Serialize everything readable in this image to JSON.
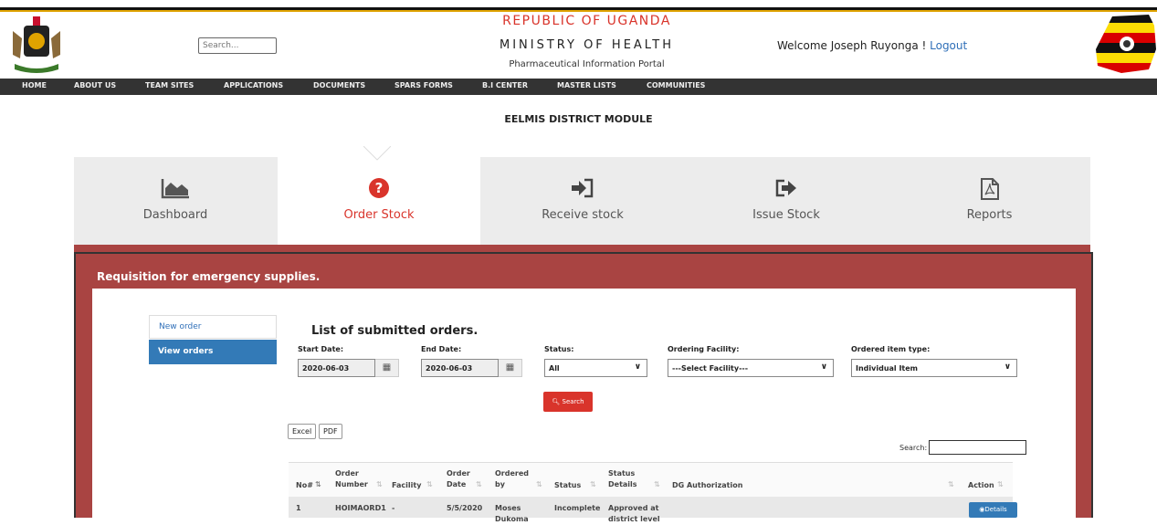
{
  "header": {
    "search_placeholder": "Search...",
    "republic": "REPUBLIC OF UGANDA",
    "ministry": "MINISTRY OF HEALTH",
    "portal": "Pharmaceutical Information Portal",
    "welcome": "Welcome Joseph Ruyonga ! ",
    "logout": "Logout"
  },
  "nav": [
    "HOME",
    "ABOUT US",
    "TEAM SITES",
    "APPLICATIONS",
    "DOCUMENTS",
    "SPARS FORMS",
    "B.I CENTER",
    "MASTER LISTS",
    "COMMUNITIES"
  ],
  "module_title": "EELMIS DISTRICT MODULE",
  "tabs": [
    {
      "label": "Dashboard",
      "icon": "area-chart-icon"
    },
    {
      "label": "Order Stock",
      "icon": "question-circle-icon"
    },
    {
      "label": "Receive stock",
      "icon": "sign-in-icon"
    },
    {
      "label": "Issue Stock",
      "icon": "share-icon"
    },
    {
      "label": "Reports",
      "icon": "pdf-file-icon"
    }
  ],
  "panel_title": "Requisition for emergency supplies.",
  "side_menu": {
    "new_order": "New order",
    "view_orders": "View orders"
  },
  "list_title": "List of submitted orders.",
  "filters": {
    "start_date_label": "Start Date:",
    "start_date": "2020-06-03",
    "end_date_label": "End Date:",
    "end_date": "2020-06-03",
    "status_label": "Status:",
    "status": "All",
    "facility_label": "Ordering Facility:",
    "facility": "---Select Facility---",
    "item_type_label": "Ordered item type:",
    "item_type": "Individual Item",
    "search_button": "Search"
  },
  "export_buttons": {
    "excel": "Excel",
    "pdf": "PDF"
  },
  "table_search_label": "Search:",
  "table": {
    "headers": [
      "No#",
      "Order Number",
      "Facility",
      "Order Date",
      "Ordered by",
      "Status",
      "Status Details",
      "DG Authorization",
      "Action"
    ],
    "rows": [
      {
        "no": "1",
        "order_number": "HOIMAORD1",
        "facility": "-",
        "order_date": "5/5/2020",
        "ordered_by": "Moses Dukoma",
        "status": "Incomplete",
        "status_details": "Approved at district level",
        "dg": "",
        "action": "Details"
      }
    ]
  },
  "colors": {
    "accent_red": "#d9342b",
    "panel_red": "#a94442",
    "nav_dark": "#333333",
    "blue": "#337ab7"
  }
}
